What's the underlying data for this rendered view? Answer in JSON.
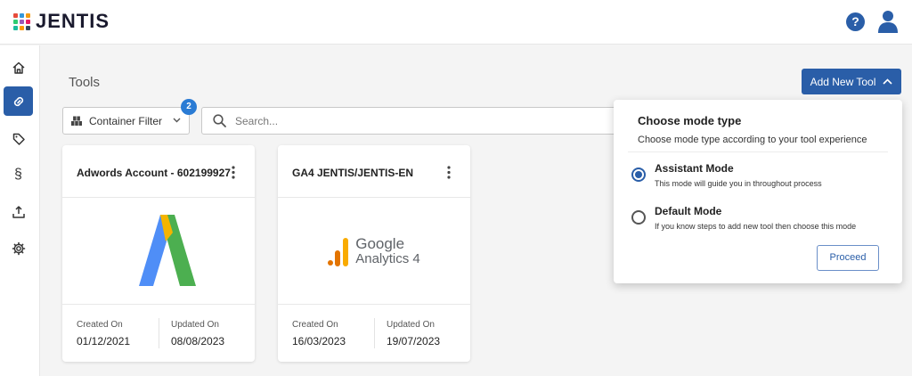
{
  "app": {
    "brand": "JENTIS",
    "help_symbol": "?",
    "brand_colors": [
      "#e74c3c",
      "#3498db",
      "#f39c12",
      "#2ecc71",
      "#9b59b6",
      "#e91e63",
      "#1abc9c",
      "#ff9800",
      "#34495e"
    ]
  },
  "sidebar": {
    "items": [
      {
        "icon": "home-icon",
        "active": false
      },
      {
        "icon": "link-icon",
        "active": true
      },
      {
        "icon": "tag-icon",
        "active": false
      },
      {
        "icon": "section-icon",
        "glyph": "§",
        "active": false
      },
      {
        "icon": "upload-icon",
        "active": false
      },
      {
        "icon": "gear-icon",
        "active": false
      }
    ]
  },
  "main": {
    "title": "Tools",
    "add_button_label": "Add New Tool",
    "filter": {
      "label": "Container Filter",
      "badge": "2"
    },
    "search": {
      "placeholder": "Search...",
      "value": ""
    }
  },
  "cards": [
    {
      "title": "Adwords Account - 602199927",
      "logo": "google-ads-logo",
      "created_label": "Created On",
      "created": "01/12/2021",
      "updated_label": "Updated On",
      "updated": "08/08/2023"
    },
    {
      "title": "GA4 JENTIS/JENTIS-EN",
      "logo": "google-analytics-4-logo",
      "logo_text_line1": "Google",
      "logo_text_line2": "Analytics 4",
      "created_label": "Created On",
      "created": "16/03/2023",
      "updated_label": "Updated On",
      "updated": "19/07/2023"
    }
  ],
  "mode_panel": {
    "title": "Choose mode type",
    "subtitle": "Choose mode type according to your tool experience",
    "options": [
      {
        "label": "Assistant Mode",
        "description": "This mode will guide you in throughout process",
        "checked": true
      },
      {
        "label": "Default Mode",
        "description": "If you know steps to add new tool then choose this mode",
        "checked": false
      }
    ],
    "proceed_label": "Proceed"
  },
  "colors": {
    "primary": "#2a5ea8",
    "badge": "#2a7bd4"
  }
}
